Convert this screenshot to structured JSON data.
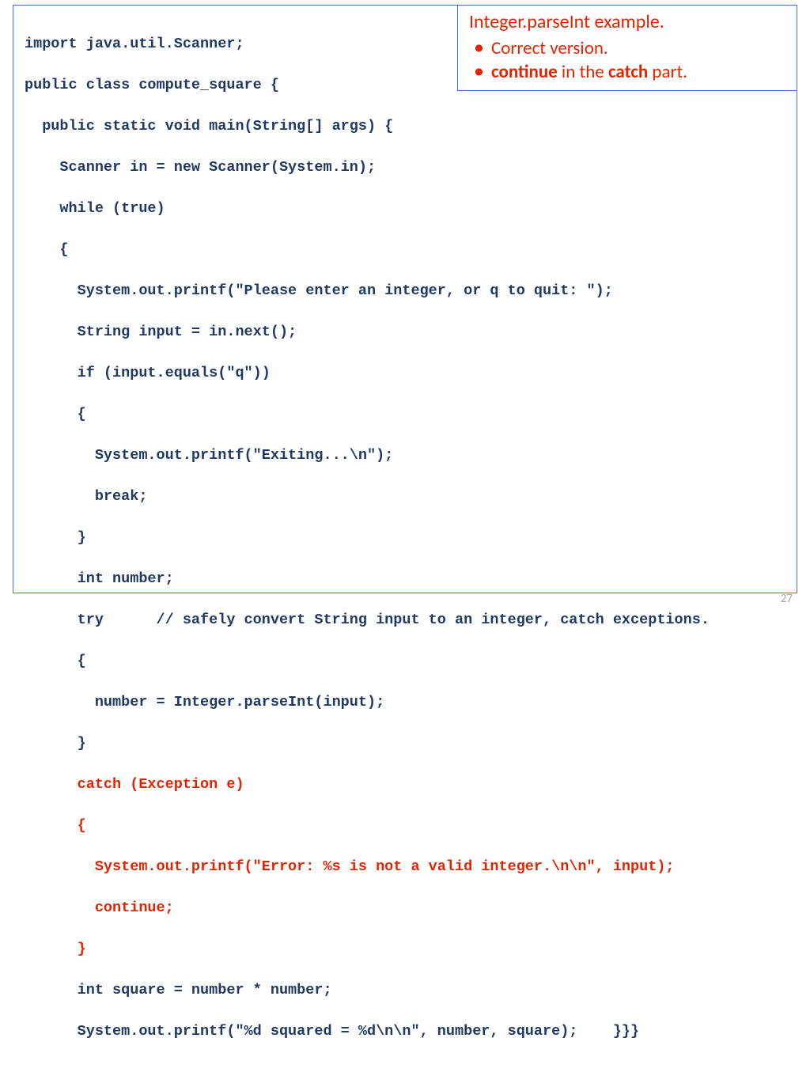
{
  "annotation": {
    "title": "Integer.parseInt example.",
    "bullets": [
      {
        "pre": "",
        "bold1": "",
        "mid": "Correct version.",
        "bold2": "",
        "post": ""
      },
      {
        "pre": "",
        "bold1": "continue",
        "mid": " in the ",
        "bold2": "catch",
        "post": " part."
      }
    ]
  },
  "code": {
    "l01": "import java.util.Scanner;",
    "l02": "public class compute_square {",
    "l03": "  public static void main(String[] args) {",
    "l04": "    Scanner in = new Scanner(System.in);",
    "l05": "    while (true)",
    "l06": "    {",
    "l07": "      System.out.printf(\"Please enter an integer, or q to quit: \");",
    "l08": "      String input = in.next();",
    "l09": "      if (input.equals(\"q\"))",
    "l10": "      {",
    "l11": "        System.out.printf(\"Exiting...\\n\");",
    "l12": "        break;",
    "l13": "      }",
    "l14": "      int number;",
    "l15": "      try      // safely convert String input to an integer, catch exceptions.",
    "l16": "      {",
    "l17": "        number = Integer.parseInt(input);",
    "l18": "      }",
    "l19": "      catch (Exception e)",
    "l20": "      {",
    "l21": "        System.out.printf(\"Error: %s is not a valid integer.\\n\\n\", input);",
    "l22": "        continue;",
    "l23": "      }",
    "l24": "      int square = number * number;",
    "l25": "      System.out.printf(\"%d squared = %d\\n\\n\", number, square);    }}}"
  },
  "page_number": "27"
}
